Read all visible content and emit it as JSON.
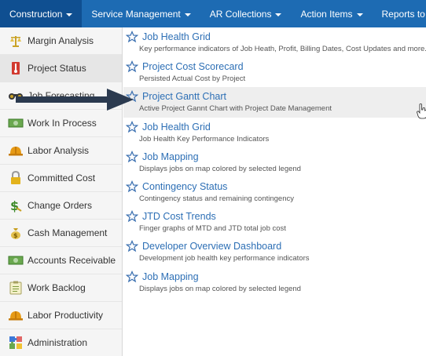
{
  "topnav": {
    "items": [
      {
        "label": "Construction",
        "caret": true
      },
      {
        "label": "Service Management",
        "caret": true
      },
      {
        "label": "AR Collections",
        "caret": true
      },
      {
        "label": "Action Items",
        "caret": true
      },
      {
        "label": "Reports to Tes",
        "caret": false
      }
    ]
  },
  "sidebar": {
    "items": [
      {
        "label": "Margin Analysis",
        "icon": "scale-icon"
      },
      {
        "label": "Project Status",
        "icon": "thermometer-icon"
      },
      {
        "label": "Job Forecasting",
        "icon": "binoculars-icon"
      },
      {
        "label": "Work In Process",
        "icon": "money-icon"
      },
      {
        "label": "Labor Analysis",
        "icon": "hardhat-icon"
      },
      {
        "label": "Committed Cost",
        "icon": "padlock-icon"
      },
      {
        "label": "Change Orders",
        "icon": "dollar-icon"
      },
      {
        "label": "Cash Management",
        "icon": "money-bag-icon"
      },
      {
        "label": "Accounts Receivable",
        "icon": "money-icon"
      },
      {
        "label": "Work Backlog",
        "icon": "clipboard-icon"
      },
      {
        "label": "Labor Productivity",
        "icon": "hardhat-icon"
      },
      {
        "label": "Administration",
        "icon": "puzzle-icon"
      }
    ]
  },
  "reports": [
    {
      "title": "Job Health Grid",
      "description": "Key performance indicators of Job Heath, Profit, Billing Dates, Cost Updates and more."
    },
    {
      "title": "Project Cost Scorecard",
      "description": "Persisted Actual Cost by Project"
    },
    {
      "title": "Project Gantt Chart",
      "description": "Active Project Gannt Chart with Project Date Management"
    },
    {
      "title": "Job Health Grid",
      "description": "Job Health Key Performance Indicators"
    },
    {
      "title": "Job Mapping",
      "description": "Displays jobs on map colored by selected legend"
    },
    {
      "title": "Contingency Status",
      "description": "Contingency status and remaining contingency"
    },
    {
      "title": "JTD Cost Trends",
      "description": "Finger graphs of MTD and JTD total job cost"
    },
    {
      "title": "Developer Overview Dashboard",
      "description": "Development job health key performance indicators"
    },
    {
      "title": "Job Mapping",
      "description": "Displays jobs on map colored by selected legend"
    }
  ],
  "colors": {
    "nav_bg": "#1d6bb3",
    "nav_active": "#0f4f91",
    "link": "#2d6fb5",
    "arrow": "#2b3a4f"
  }
}
